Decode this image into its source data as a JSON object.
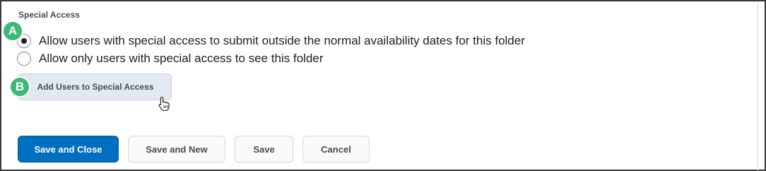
{
  "section": {
    "title": "Special Access"
  },
  "options": [
    {
      "label": "Allow users with special access to submit outside the normal availability dates for this folder",
      "checked": true
    },
    {
      "label": "Allow only users with special access to see this folder",
      "checked": false
    }
  ],
  "callouts": {
    "a": "A",
    "b": "B"
  },
  "add_users_button": {
    "label": "Add Users to Special Access"
  },
  "footer": {
    "save_and_close": "Save and Close",
    "save_and_new": "Save and New",
    "save": "Save",
    "cancel": "Cancel"
  },
  "colors": {
    "primary": "#006fbf",
    "callout": "#3cb878",
    "secondary_button_bg": "#e3e9f1"
  }
}
